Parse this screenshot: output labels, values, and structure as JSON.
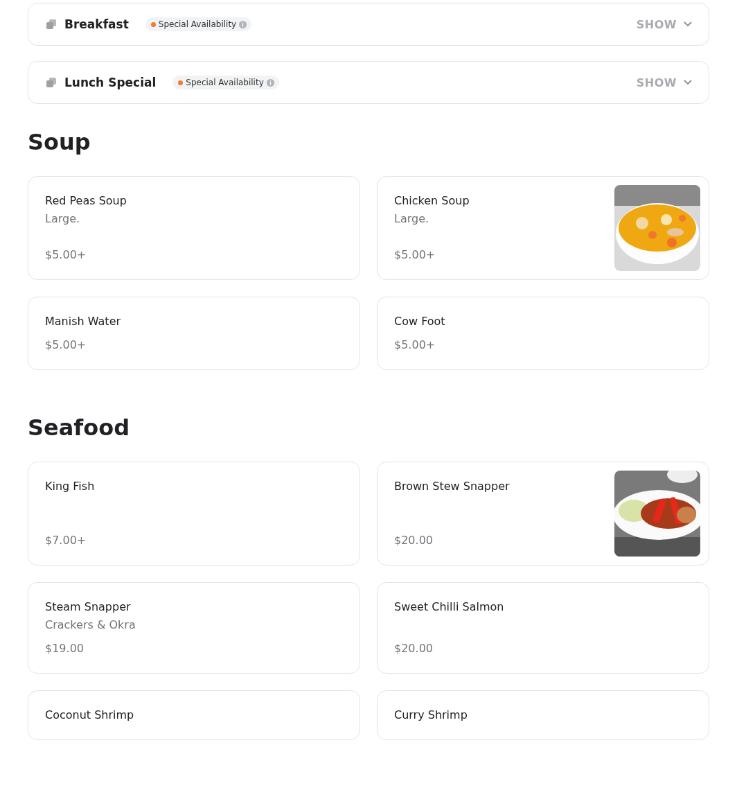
{
  "menus": [
    {
      "title": "Breakfast",
      "badge": "Special Availability",
      "toggle": "SHOW",
      "expanded": false
    },
    {
      "title": "Lunch Special",
      "badge": "Special Availability",
      "toggle": "SHOW",
      "expanded": false
    }
  ],
  "sections": [
    {
      "title": "Soup",
      "items": [
        {
          "name": "Red Peas Soup",
          "description": "Large.",
          "price": "$5.00+"
        },
        {
          "name": "Chicken Soup",
          "description": "Large.",
          "price": "$5.00+"
        },
        {
          "name": "Manish Water",
          "price": "$5.00+"
        },
        {
          "name": "Cow Foot",
          "price": "$5.00+"
        }
      ]
    },
    {
      "title": "Seafood",
      "items": [
        {
          "name": "King Fish",
          "price": "$7.00+",
          "tall": true
        },
        {
          "name": "Brown Stew Snapper",
          "price": "$20.00"
        },
        {
          "name": "Steam Snapper",
          "description": "Crackers & Okra",
          "price": "$19.00"
        },
        {
          "name": "Sweet Chilli Salmon",
          "price": "$20.00"
        },
        {
          "name": "Coconut Shrimp"
        },
        {
          "name": "Curry Shrimp"
        }
      ]
    }
  ]
}
